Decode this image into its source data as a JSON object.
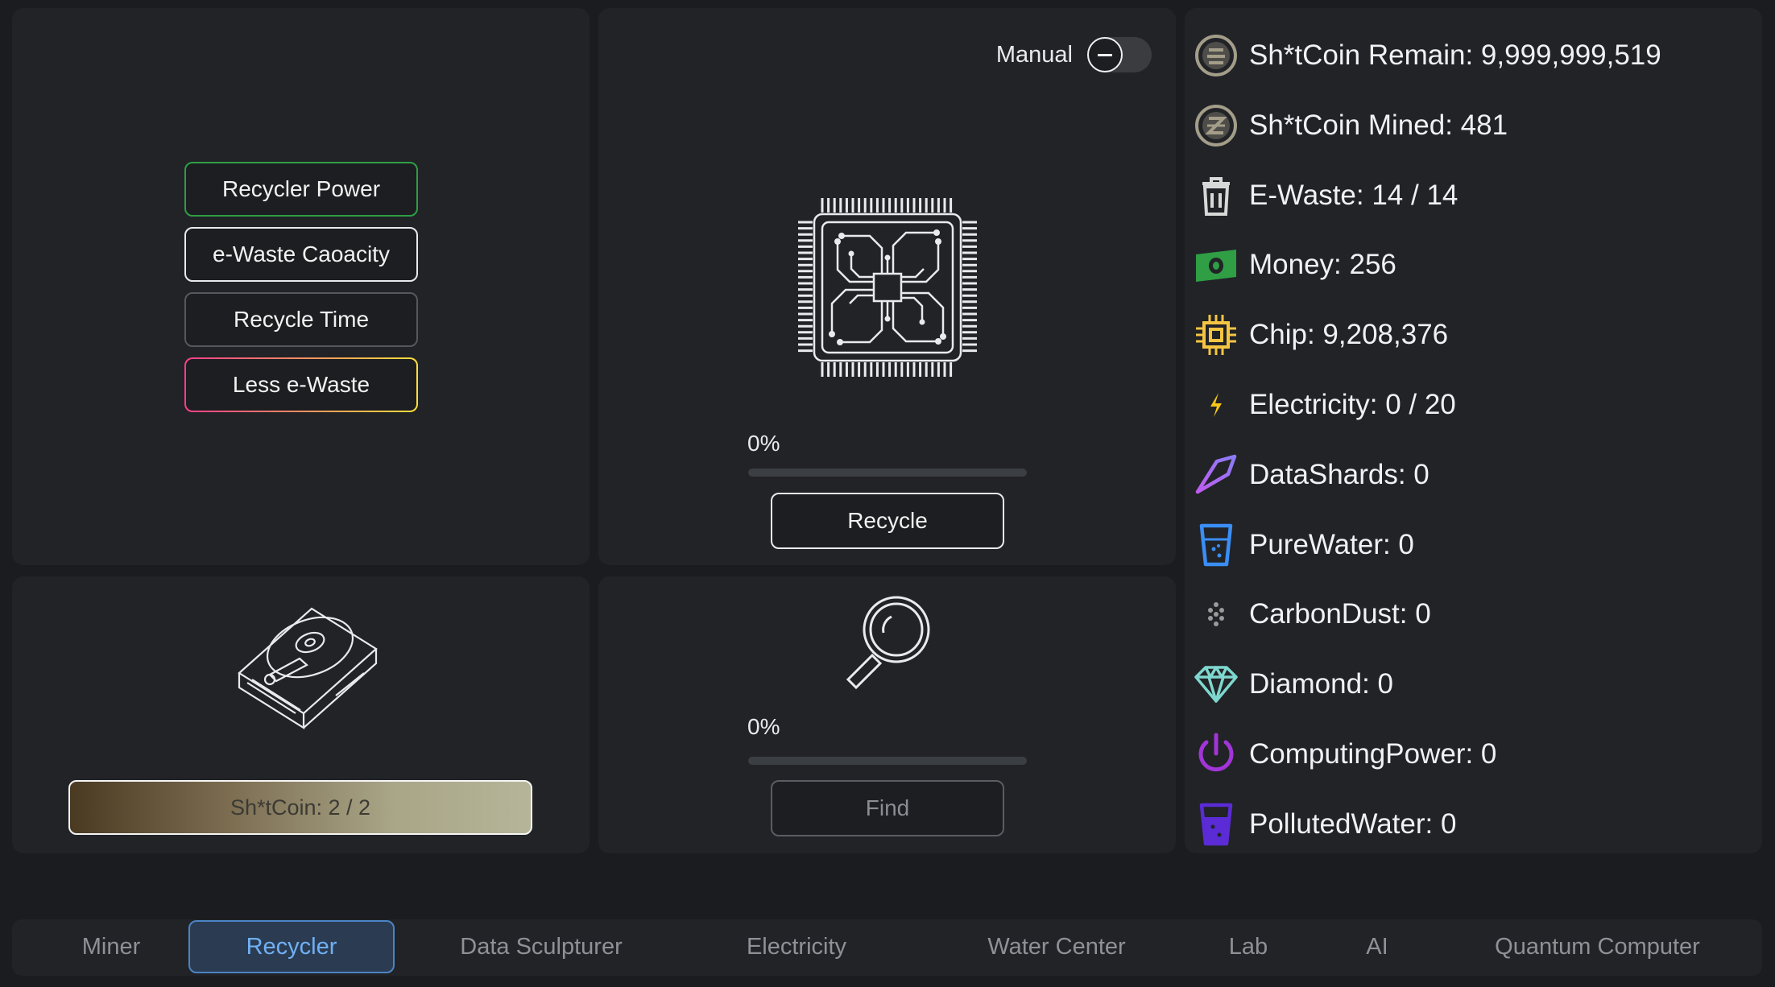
{
  "upgrades": {
    "recycler_power": "Recycler Power",
    "ewaste_capacity": "e-Waste Caoacity",
    "recycle_time": "Recycle Time",
    "less_ewaste": "Less e-Waste"
  },
  "recycle_panel": {
    "manual_label": "Manual",
    "manual_enabled": false,
    "progress_text": "0%",
    "progress": 0,
    "recycle_button": "Recycle",
    "chip_icon": "chip-icon"
  },
  "hdd_panel": {
    "hdd_icon": "hard-drive-icon",
    "coin_label": "Sh*tCoin: 2  / 2"
  },
  "find_panel": {
    "search_icon": "magnifier-icon",
    "progress_text": "0%",
    "progress": 0,
    "find_button": "Find"
  },
  "resources": [
    {
      "icon": "coin-stack-icon",
      "text": "Sh*tCoin Remain: 9,999,999,519",
      "color": "#a39d89"
    },
    {
      "icon": "coin-mined-icon",
      "text": "Sh*tCoin Mined: 481",
      "color": "#a39d89"
    },
    {
      "icon": "trash-icon",
      "text": "E-Waste: 14 / 14",
      "color": "#d8d8d8"
    },
    {
      "icon": "money-icon",
      "text": "Money: 256",
      "color": "#2f9e44"
    },
    {
      "icon": "chip-icon",
      "text": "Chip: 9,208,376",
      "color": "#f5c542"
    },
    {
      "icon": "bolt-icon",
      "text": "Electricity: 0 / 20",
      "color": "#f5c518"
    },
    {
      "icon": "shard-icon",
      "text": "DataShards: 0",
      "color": "#b06cf0"
    },
    {
      "icon": "glass-icon",
      "text": "PureWater: 0",
      "color": "#3a8ef5"
    },
    {
      "icon": "dust-icon",
      "text": "CarbonDust: 0",
      "color": "#9a9a9a"
    },
    {
      "icon": "diamond-icon",
      "text": "Diamond: 0",
      "color": "#7fd8cf"
    },
    {
      "icon": "power-icon",
      "text": "ComputingPower: 0",
      "color": "#a235d6"
    },
    {
      "icon": "polluted-glass-icon",
      "text": "PollutedWater: 0",
      "color": "#5b2bd6"
    }
  ],
  "nav": {
    "active": "Recycler",
    "tabs": [
      "Miner",
      "Recycler",
      "Data Sculpturer",
      "Electricity",
      "Water Center",
      "Lab",
      "AI",
      "Quantum Computer"
    ]
  }
}
